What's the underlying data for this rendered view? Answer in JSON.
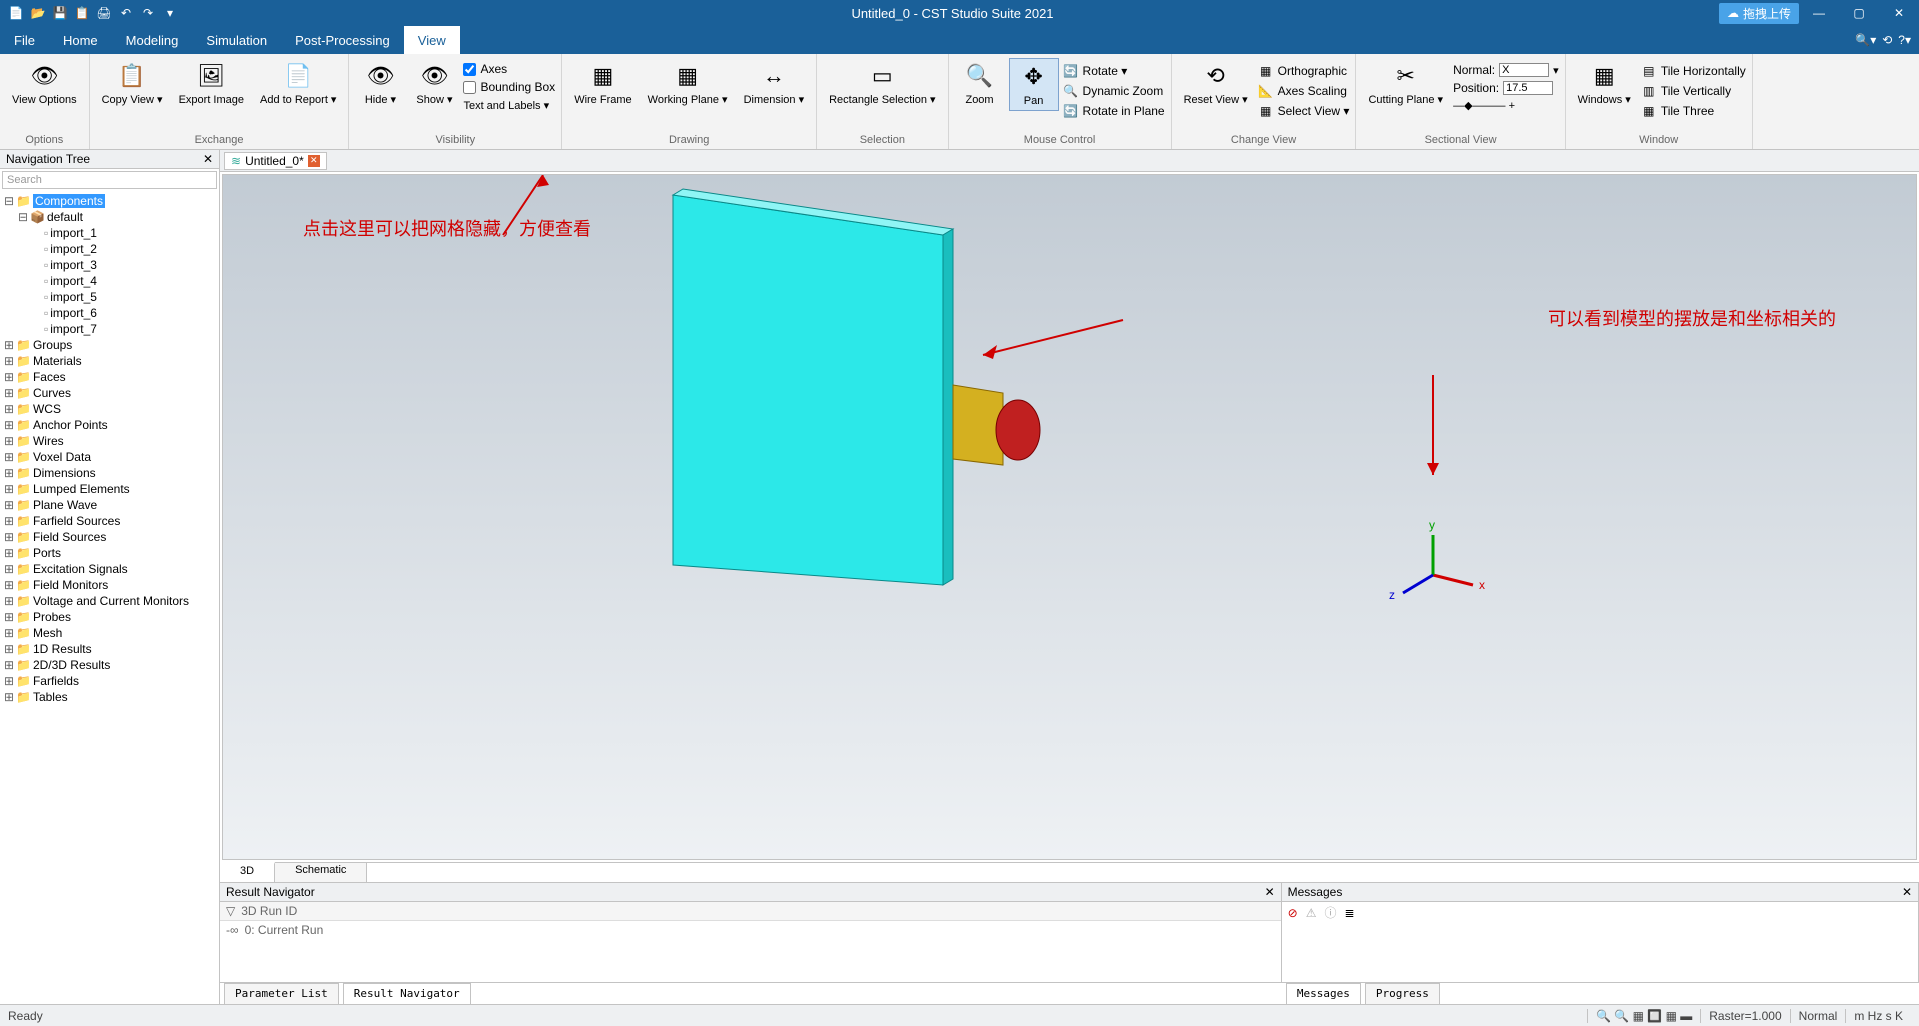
{
  "titlebar": {
    "title": "Untitled_0 - CST Studio Suite 2021",
    "upload": "拖拽上传"
  },
  "menu": {
    "file": "File",
    "home": "Home",
    "modeling": "Modeling",
    "simulation": "Simulation",
    "postprocessing": "Post-Processing",
    "view": "View"
  },
  "ribbon": {
    "options": {
      "view_options": "View\nOptions",
      "group": "Options"
    },
    "exchange": {
      "copy_view": "Copy\nView ▾",
      "export_image": "Export\nImage",
      "add_report": "Add to\nReport ▾",
      "group": "Exchange"
    },
    "visibility": {
      "hide": "Hide ▾",
      "show": "Show ▾",
      "axes": "Axes",
      "bounding": "Bounding Box",
      "textlabels": "Text and Labels ▾",
      "group": "Visibility"
    },
    "drawing": {
      "wireframe": "Wire\nFrame",
      "workingplane": "Working\nPlane ▾",
      "dimension": "Dimension ▾",
      "group": "Drawing"
    },
    "selection": {
      "rect": "Rectangle\nSelection ▾",
      "group": "Selection"
    },
    "mouse": {
      "zoom": "Zoom",
      "pan": "Pan",
      "rotate": "Rotate ▾",
      "dynzoom": "Dynamic Zoom",
      "rotplane": "Rotate in Plane",
      "group": "Mouse Control"
    },
    "changeview": {
      "reset": "Reset\nView ▾",
      "ortho": "Orthographic",
      "axesscale": "Axes Scaling",
      "selview": "Select View ▾",
      "group": "Change View"
    },
    "sectional": {
      "cutting": "Cutting\nPlane ▾",
      "normal_label": "Normal:",
      "normal_value": "X",
      "position_label": "Position:",
      "position_value": "17.5",
      "group": "Sectional View"
    },
    "window": {
      "windows": "Windows ▾",
      "tileh": "Tile Horizontally",
      "tilev": "Tile Vertically",
      "tile3": "Tile Three",
      "group": "Window"
    }
  },
  "navtree": {
    "title": "Navigation Tree",
    "search": "Search",
    "root": "Components",
    "default": "default",
    "imports": [
      "import_1",
      "import_2",
      "import_3",
      "import_4",
      "import_5",
      "import_6",
      "import_7"
    ],
    "items": [
      "Groups",
      "Materials",
      "Faces",
      "Curves",
      "WCS",
      "Anchor Points",
      "Wires",
      "Voxel Data",
      "Dimensions",
      "Lumped Elements",
      "Plane Wave",
      "Farfield Sources",
      "Field Sources",
      "Ports",
      "Excitation Signals",
      "Field Monitors",
      "Voltage and Current Monitors",
      "Probes",
      "Mesh",
      "1D Results",
      "2D/3D Results",
      "Farfields",
      "Tables"
    ]
  },
  "doctab": {
    "name": "Untitled_0*"
  },
  "annotations": {
    "left": "点击这里可以把网格隐藏，方便查看",
    "right": "可以看到模型的摆放是和坐标相关的"
  },
  "axes": {
    "x": "x",
    "y": "y",
    "z": "z"
  },
  "viewtabs": {
    "three_d": "3D",
    "schematic": "Schematic"
  },
  "result_nav": {
    "title": "Result Navigator",
    "runid": "3D Run ID",
    "current": "0: Current Run"
  },
  "messages": {
    "title": "Messages"
  },
  "bottom_tabs": {
    "param": "Parameter List",
    "resnav": "Result Navigator",
    "msg": "Messages",
    "prog": "Progress"
  },
  "status": {
    "ready": "Ready",
    "raster": "Raster=1.000",
    "normal": "Normal",
    "units": "m Hz s K"
  }
}
